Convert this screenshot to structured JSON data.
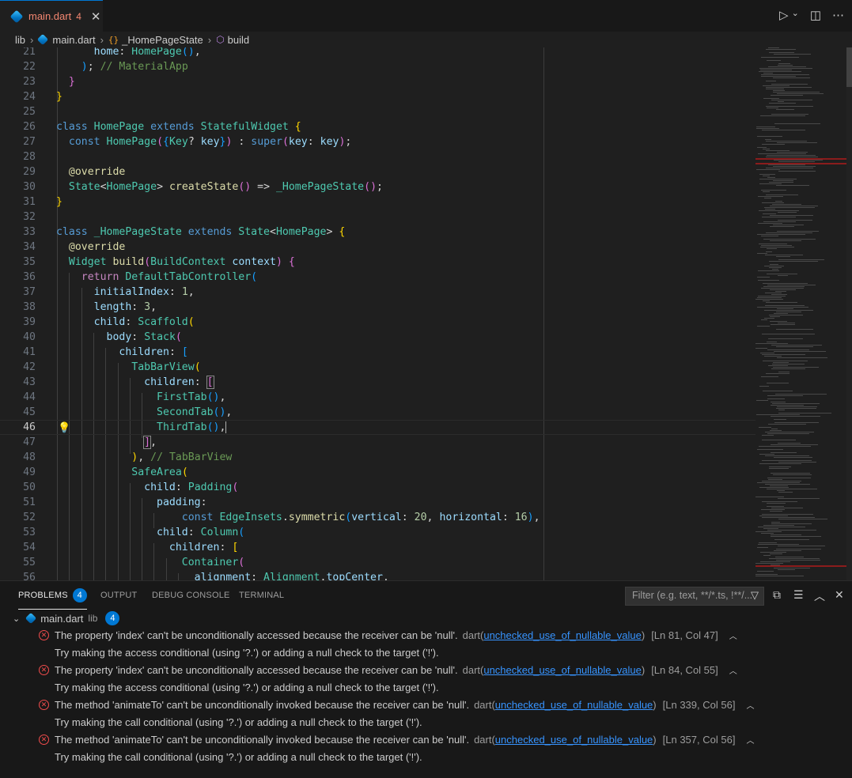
{
  "tab": {
    "filename": "main.dart",
    "problem_count": "4",
    "close": "✕",
    "icon": "dart-icon"
  },
  "titlebar_icons": {
    "run": "▷",
    "run_menu": "⌄",
    "split": "◫",
    "more": "⋯"
  },
  "breadcrumb": {
    "folder": "lib",
    "file": "main.dart",
    "class": "_HomePageState",
    "method": "build",
    "sep": "›",
    "class_icon": "{}",
    "method_icon": "⬡"
  },
  "editor": {
    "active_line": "46",
    "line_numbers": [
      "21",
      "22",
      "23",
      "24",
      "25",
      "26",
      "27",
      "28",
      "29",
      "30",
      "31",
      "32",
      "33",
      "34",
      "35",
      "36",
      "37",
      "38",
      "39",
      "40",
      "41",
      "42",
      "43",
      "44",
      "45",
      "46",
      "47",
      "48",
      "49",
      "50",
      "51",
      "52",
      "53",
      "54",
      "55",
      "56"
    ]
  },
  "panel": {
    "tabs": {
      "problems": "PROBLEMS",
      "problems_count": "4",
      "output": "OUTPUT",
      "debug_console": "DEBUG CONSOLE",
      "terminal": "TERMINAL"
    },
    "filter_placeholder": "Filter (e.g. text, **/*.ts, !**/...",
    "icons": {
      "filter": "filter-icon",
      "collapse": "collapse-all-icon",
      "view": "view-as-list-icon",
      "maximize": "chevron-up-icon",
      "close": "close-icon"
    },
    "file_group": {
      "name": "main.dart",
      "dir": "lib",
      "count": "4"
    },
    "problems": [
      {
        "message": "The property 'index' can't be unconditionally accessed because the receiver can be 'null'.",
        "source": "dart(",
        "code": "unchecked_use_of_nullable_value",
        "source_end": ")",
        "location": "[Ln 81, Col 47]",
        "hint": "Try making the access conditional (using '?.') or adding a null check to the target ('!')."
      },
      {
        "message": "The property 'index' can't be unconditionally accessed because the receiver can be 'null'.",
        "source": "dart(",
        "code": "unchecked_use_of_nullable_value",
        "source_end": ")",
        "location": "[Ln 84, Col 55]",
        "hint": "Try making the access conditional (using '?.') or adding a null check to the target ('!')."
      },
      {
        "message": "The method 'animateTo' can't be unconditionally invoked because the receiver can be 'null'.",
        "source": "dart(",
        "code": "unchecked_use_of_nullable_value",
        "source_end": ")",
        "location": "[Ln 339, Col 56]",
        "hint": "Try making the call conditional (using '?.') or adding a null check to the target ('!')."
      },
      {
        "message": "The method 'animateTo' can't be unconditionally invoked because the receiver can be 'null'.",
        "source": "dart(",
        "code": "unchecked_use_of_nullable_value",
        "source_end": ")",
        "location": "[Ln 357, Col 56]",
        "hint": "Try making the call conditional (using '?.') or adding a null check to the target ('!')."
      }
    ]
  },
  "colors": {
    "accent": "#0078d4",
    "error": "#f14c4c",
    "keyword": "#569cd6",
    "type": "#4ec9b0",
    "function": "#dcdcaa",
    "property": "#9cdcfe"
  }
}
